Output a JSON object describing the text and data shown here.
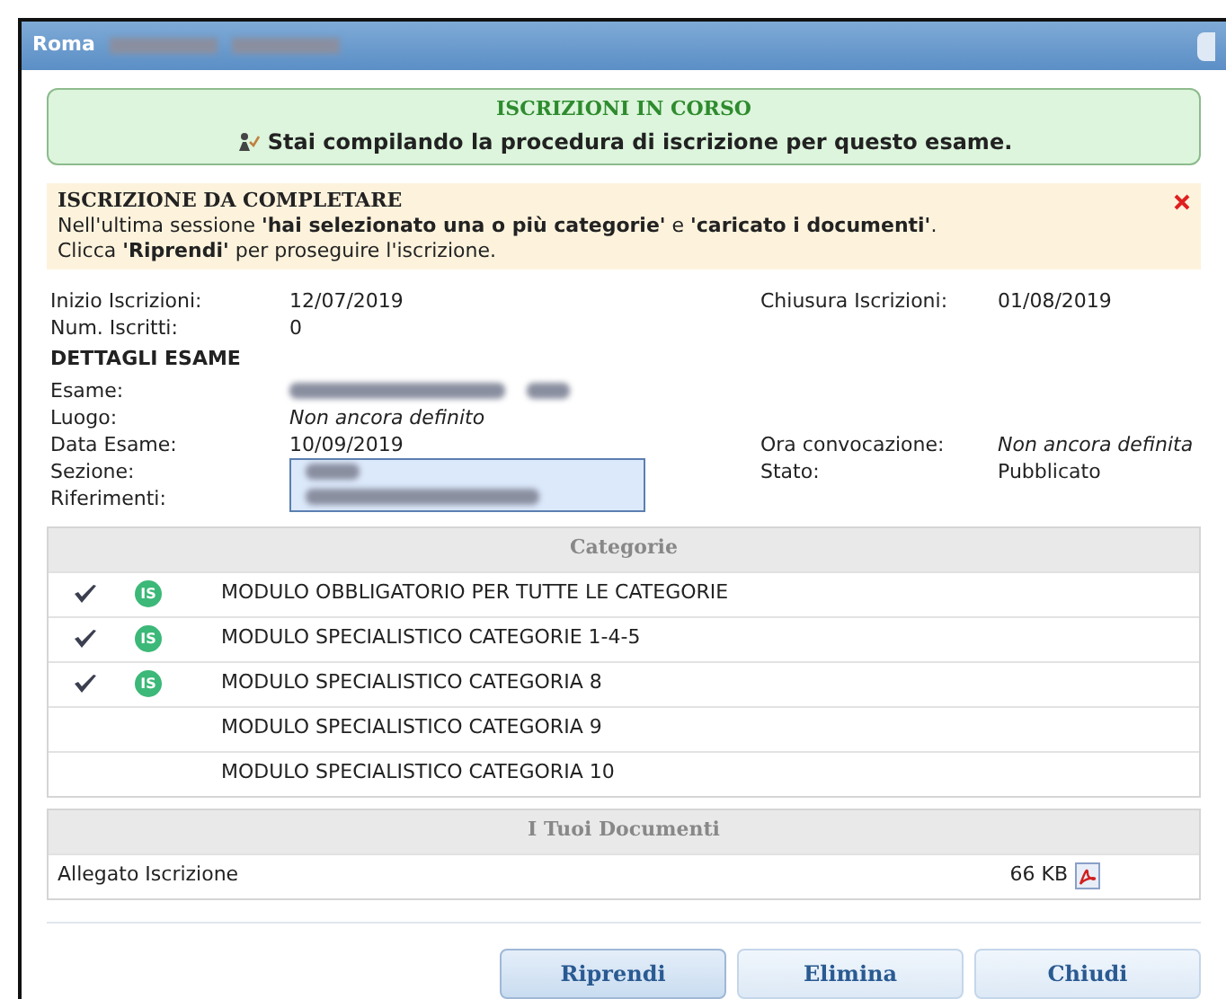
{
  "window": {
    "title": "Roma",
    "title_redacted": true
  },
  "status_box": {
    "title": "ISCRIZIONI IN CORSO",
    "message": "Stai compilando la procedura di iscrizione per questo esame."
  },
  "notice": {
    "title": "ISCRIZIONE DA COMPLETARE",
    "lines": [
      "Nell'ultima sessione **'hai selezionato una o più categorie'** e **'caricato i documenti'**.",
      "Clicca **'Riprendi'** per proseguire l'iscrizione."
    ]
  },
  "registration": [
    {
      "label": "Inizio Iscrizioni:",
      "value": "12/07/2019",
      "right_label": "Chiusura Iscrizioni:",
      "right_value": "01/08/2019"
    },
    {
      "label": "Num. Iscritti:",
      "value": "0"
    }
  ],
  "details": {
    "title": "DETTAGLI ESAME",
    "rows": [
      {
        "label": "Esame:",
        "kind": "redacted"
      },
      {
        "label": "Luogo:",
        "kind": "text",
        "value": "Non ancora definito",
        "italic": true
      },
      {
        "label": "Data Esame:",
        "kind": "text",
        "value": "10/09/2019",
        "italic": false,
        "right_label": "Ora convocazione:",
        "right_value": "Non ancora definita",
        "right_italic": true
      },
      {
        "label": "Sezione:",
        "kind": "highlight",
        "right_label": "Stato:",
        "right_value": "Pubblicato",
        "right_italic": false
      },
      {
        "label": "Riferimenti:",
        "kind": "highlight"
      }
    ]
  },
  "categories": {
    "title": "Categorie",
    "rows": [
      {
        "name": "MODULO OBBLIGATORIO PER TUTTE LE CATEGORIE",
        "checked": true,
        "badge": "IS"
      },
      {
        "name": "MODULO SPECIALISTICO CATEGORIE 1-4-5",
        "checked": true,
        "badge": "IS"
      },
      {
        "name": "MODULO SPECIALISTICO CATEGORIA 8",
        "checked": true,
        "badge": "IS"
      },
      {
        "name": "MODULO SPECIALISTICO CATEGORIA 9",
        "checked": false
      },
      {
        "name": "MODULO SPECIALISTICO CATEGORIA 10",
        "checked": false
      }
    ]
  },
  "documents": {
    "title": "I Tuoi Documenti",
    "rows": [
      {
        "name": "Allegato Iscrizione",
        "size": "66 KB"
      }
    ]
  },
  "buttons": [
    {
      "label": "Riprendi",
      "selected": true
    },
    {
      "label": "Elimina",
      "selected": false
    },
    {
      "label": "Chiudi",
      "selected": false
    }
  ]
}
